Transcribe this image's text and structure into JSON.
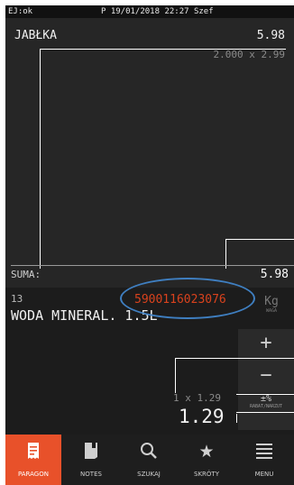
{
  "status": {
    "left": "EJ:ok",
    "center": "P 19/01/2018 22:27 Szef"
  },
  "receipt": {
    "item": "JABŁKA",
    "item_total": "5.98",
    "qty_line": "2.000 x 2.99",
    "sum_label": "SUMA:",
    "sum_value": "5.98"
  },
  "current": {
    "number": "13",
    "barcode": "5900116023076",
    "name": "WODA MINERAL. 1.5L",
    "unit": "Kg",
    "unit_sub": "WAGA",
    "qty_line": "1 x 1.29",
    "amount": "1.29"
  },
  "buttons": {
    "plus": "+",
    "minus": "−",
    "percent": "±%",
    "percent_sub": "RABAT/NARZUT"
  },
  "tabs": [
    {
      "label": "PARAGON",
      "icon": "receipt-icon"
    },
    {
      "label": "NOTES",
      "icon": "notes-icon"
    },
    {
      "label": "SZUKAJ",
      "icon": "search-icon"
    },
    {
      "label": "SKRÓTY",
      "icon": "star-icon"
    },
    {
      "label": "MENU",
      "icon": "menu-icon"
    }
  ],
  "colors": {
    "accent": "#e8512a",
    "barcode": "#d9421d",
    "annotation": "#3f7fc1"
  }
}
